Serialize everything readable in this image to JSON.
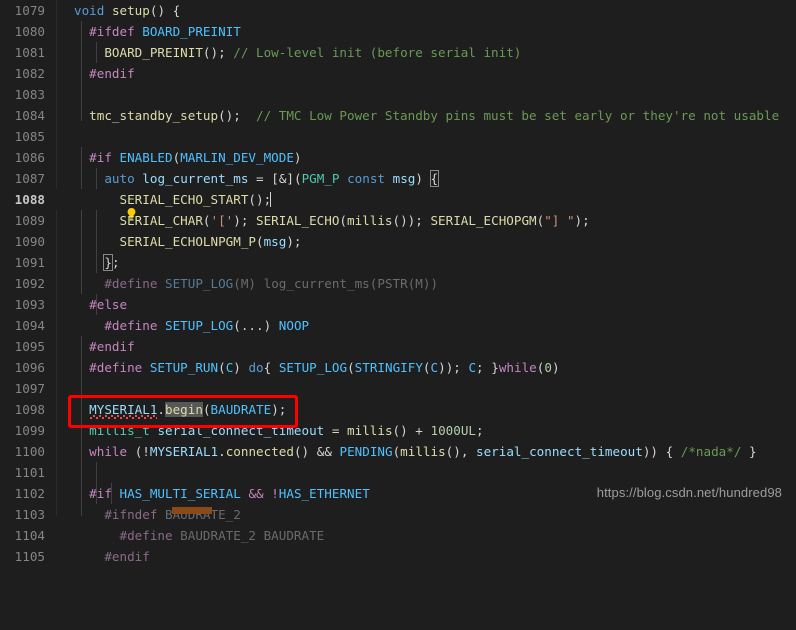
{
  "editor": {
    "theme_background": "#1e1e1e",
    "line_number_color": "#858585",
    "first_line": 1079,
    "active_line": 1088,
    "bulb_icon": "lightbulb-icon",
    "bulb_glyph": "💡"
  },
  "annotation": {
    "box_color": "#ff0000",
    "target_line": 1098,
    "target_text": "MYSERIAL1.begin(BAUDRATE);"
  },
  "scrollbar": {
    "orientation": "horizontal",
    "thumb_color": "#8a4a16"
  },
  "watermark": {
    "text": "https://blog.csdn.net/hundred98"
  },
  "lines": [
    {
      "n": "1079",
      "text": "void setup() {"
    },
    {
      "n": "1080",
      "text": "  #ifdef BOARD_PREINIT"
    },
    {
      "n": "1081",
      "text": "    BOARD_PREINIT(); // Low-level init (before serial init)"
    },
    {
      "n": "1082",
      "text": "  #endif"
    },
    {
      "n": "1083",
      "text": ""
    },
    {
      "n": "1084",
      "text": "  tmc_standby_setup();  // TMC Low Power Standby pins must be set early or they're not usable"
    },
    {
      "n": "1085",
      "text": ""
    },
    {
      "n": "1086",
      "text": "  #if ENABLED(MARLIN_DEV_MODE)"
    },
    {
      "n": "1087",
      "text": "    auto log_current_ms = [&](PGM_P const msg) {"
    },
    {
      "n": "1088",
      "text": "      SERIAL_ECHO_START();"
    },
    {
      "n": "1089",
      "text": "      SERIAL_CHAR('['); SERIAL_ECHO(millis()); SERIAL_ECHOPGM(\"] \");"
    },
    {
      "n": "1090",
      "text": "      SERIAL_ECHOLNPGM_P(msg);"
    },
    {
      "n": "1091",
      "text": "    };"
    },
    {
      "n": "1092",
      "text": "    #define SETUP_LOG(M) log_current_ms(PSTR(M))"
    },
    {
      "n": "1093",
      "text": "  #else"
    },
    {
      "n": "1094",
      "text": "    #define SETUP_LOG(...) NOOP"
    },
    {
      "n": "1095",
      "text": "  #endif"
    },
    {
      "n": "1096",
      "text": "  #define SETUP_RUN(C) do{ SETUP_LOG(STRINGIFY(C)); C; }while(0)"
    },
    {
      "n": "1097",
      "text": ""
    },
    {
      "n": "1098",
      "text": "  MYSERIAL1.begin(BAUDRATE);"
    },
    {
      "n": "1099",
      "text": "  millis_t serial_connect_timeout = millis() + 1000UL;"
    },
    {
      "n": "1100",
      "text": "  while (!MYSERIAL1.connected() && PENDING(millis(), serial_connect_timeout)) { /*nada*/ }"
    },
    {
      "n": "1101",
      "text": ""
    },
    {
      "n": "1102",
      "text": "  #if HAS_MULTI_SERIAL && !HAS_ETHERNET"
    },
    {
      "n": "1103",
      "text": "    #ifndef BAUDRATE_2"
    },
    {
      "n": "1104",
      "text": "      #define BAUDRATE_2 BAUDRATE"
    },
    {
      "n": "1105",
      "text": "    #endif"
    }
  ]
}
